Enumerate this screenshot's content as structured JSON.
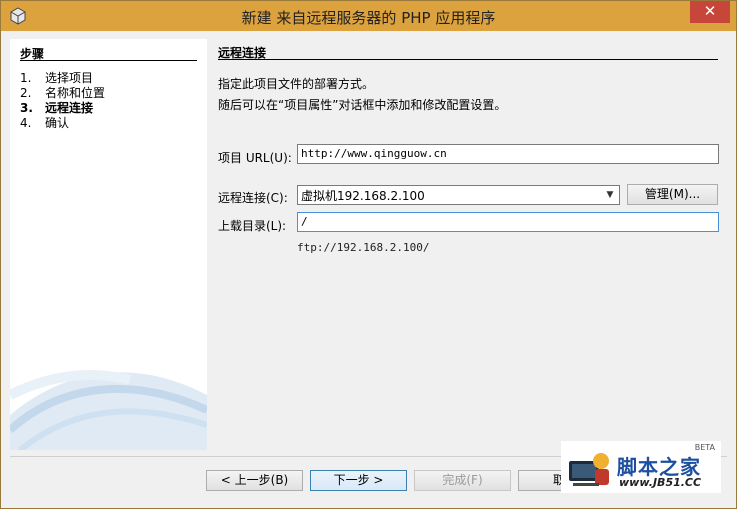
{
  "window": {
    "title": "新建 来自远程服务器的 PHP 应用程序",
    "close_glyph": "✕"
  },
  "steps": {
    "title": "步骤",
    "items": [
      {
        "num": "1.",
        "label": "选择项目"
      },
      {
        "num": "2.",
        "label": "名称和位置"
      },
      {
        "num": "3.",
        "label": "远程连接"
      },
      {
        "num": "4.",
        "label": "确认"
      }
    ],
    "current_index": 2
  },
  "main": {
    "title": "远程连接",
    "desc_line1": "指定此项目文件的部署方式。",
    "desc_line2": "随后可以在“项目属性”对话框中添加和修改配置设置。",
    "project_url": {
      "label": "项目 URL(U):",
      "value": "http://www.qingguow.cn"
    },
    "remote_connection": {
      "label": "远程连接(C):",
      "value": "虚拟机192.168.2.100"
    },
    "manage_button": "管理(M)...",
    "upload_dir": {
      "label": "上载目录(L):",
      "value": "/"
    },
    "ftp_hint": "ftp://192.168.2.100/"
  },
  "footer": {
    "back": "< 上一步(B)",
    "next": "下一步 >",
    "finish": "完成(F)",
    "cancel_partial": "取"
  },
  "watermark": {
    "name": "脚本之家",
    "url": "www.JB51.CC",
    "badge": "BETA"
  }
}
